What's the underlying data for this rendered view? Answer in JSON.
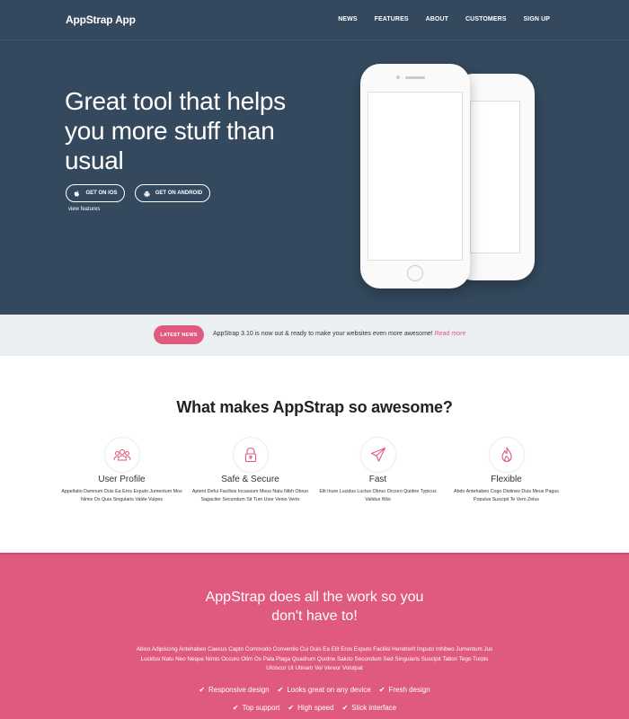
{
  "header": {
    "brand": "AppStrap App",
    "nav": [
      "NEWS",
      "FEATURES",
      "ABOUT",
      "CUSTOMERS",
      "SIGN UP"
    ]
  },
  "hero": {
    "headline": "Great tool that helps you more stuff than usual",
    "ios_button": "GET ON IOS",
    "android_button": "GET ON ANDROID",
    "view_features": "view features"
  },
  "news": {
    "badge": "LATEST NEWS",
    "text": "AppStrap 3.10 is now out & ready to make your websites even more awesome!",
    "link": "Read more"
  },
  "features": {
    "title": "What makes AppStrap so awesome?",
    "items": [
      {
        "icon": "users-icon",
        "title": "User Profile",
        "desc": "Appellatio Damnum Duis Ea Eros Exputo Jumentum Mos Nimis Os Quia Singularis Valde Vulpes"
      },
      {
        "icon": "lock-icon",
        "title": "Safe & Secure",
        "desc": "Aptent Defui Facilisis Incassum Meus Natu Nibh Obruo Sagaciter Secundum Sit Tum Usor Venio Verto"
      },
      {
        "icon": "paper-plane-icon",
        "title": "Fast",
        "desc": "Elit Iriure Lucidus Luctus Obruo Occuro Quidne Typicus Validus Wisi"
      },
      {
        "icon": "flame-icon",
        "title": "Flexible",
        "desc": "Abdo Antehabeo Cogo Distineo Duis Meus Pagus Populus Suscipit Te Vero Zelus"
      }
    ]
  },
  "cta": {
    "title_line1": "AppStrap does all the work so you",
    "title_line2": "don't have to!",
    "text": "Abico Adipiscing Antehabeo Caecus Capto Commodo Conventio Cui Duis Ea Elit Eros Exputo Facilisi Hendrerit Imputo Inhibeo Jumentum Jus Lucidus Natu Neo Neque Nimis Occuro Olim Os Pala Plaga Quadrum Quidne Saluto Secundum Sed Singularis Suscipit Tation Tego Turpis Ulciscor Ut Utinam Vel Vereor Volutpat",
    "checks_row1": [
      "Responsive design",
      "Looks great on any device",
      "Fresh design"
    ],
    "checks_row2": [
      "Top support",
      "High speed",
      "Slick interface"
    ]
  },
  "colors": {
    "hero_bg": "#34495e",
    "accent": "#df5a7e",
    "news_bg": "#eceff1"
  }
}
